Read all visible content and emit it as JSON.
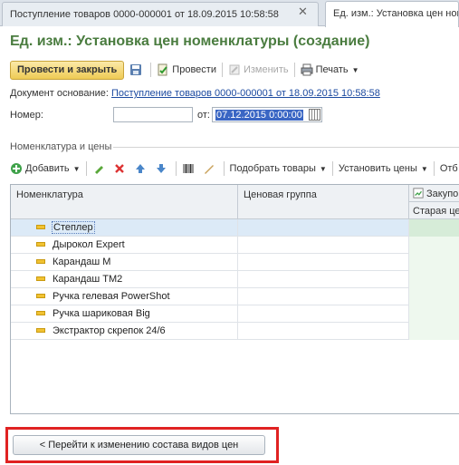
{
  "tabs": [
    {
      "label": "Поступление товаров 0000-000001 от 18.09.2015 10:58:58"
    },
    {
      "label": "Ед. изм.: Установка цен номенклатуры (создание)"
    }
  ],
  "tab_close": "✕",
  "form": {
    "title": "Ед. изм.: Установка цен номенклатуры (создание)",
    "post_close_label": "Провести и закрыть",
    "post_label": "Провести",
    "edit_label": "Изменить",
    "print_label": "Печать",
    "base_doc_label": "Документ основание:",
    "base_doc_link": "Поступление товаров 0000-000001 от 18.09.2015 10:58:58",
    "number_label": "Номер:",
    "number_value": "",
    "date_label": "от:",
    "date_value": "07.12.2015  0:00:00"
  },
  "section": {
    "title": "Номенклатура и цены",
    "add_label": "Добавить",
    "select_goods_label": "Подобрать товары",
    "set_prices_label": "Установить цены",
    "more_label": "Отб"
  },
  "table": {
    "col_nomenclature": "Номенклатура",
    "col_price_group": "Ценовая группа",
    "col_purchase": "Закупо",
    "col_old_price": "Старая цен",
    "rows": [
      {
        "name": "Степлер",
        "price_group": ""
      },
      {
        "name": "Дырокол Expert",
        "price_group": ""
      },
      {
        "name": "Карандаш М",
        "price_group": ""
      },
      {
        "name": "Карандаш ТМ2",
        "price_group": ""
      },
      {
        "name": "Ручка гелевая PowerShot",
        "price_group": ""
      },
      {
        "name": "Ручка шариковая Big",
        "price_group": ""
      },
      {
        "name": "Экстрактор скрепок 24/6",
        "price_group": ""
      }
    ]
  },
  "bottom_button": "< Перейти к изменению состава видов цен",
  "colors": {
    "title_green": "#4a7c3f",
    "primary_button": "#efcb55",
    "highlight_frame": "#e02222",
    "selection": "#dceaf7"
  }
}
